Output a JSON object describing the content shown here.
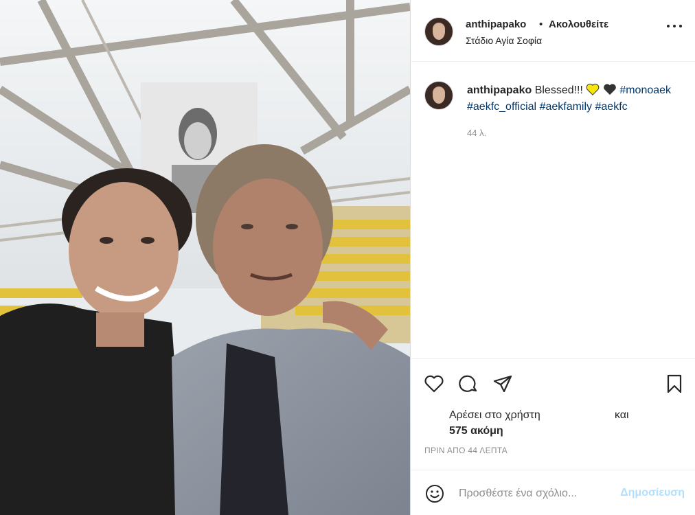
{
  "post": {
    "photo_alt": "anthipapako selfie"
  },
  "header": {
    "username": "anthipapako",
    "dot": "•",
    "follow_label": "Ακολουθείτε",
    "location": "Στάδιο Αγία Σοφία"
  },
  "caption": {
    "username": "anthipapako",
    "text": "Blessed!!!",
    "hashtags": [
      "#monoaek",
      "#aekfc_official",
      "#aekfamily",
      "#aekfc"
    ],
    "time_ago": "44 λ."
  },
  "actions": {
    "icons": [
      "heart-icon",
      "comment-icon",
      "share-icon",
      "bookmark-icon"
    ],
    "likes_prefix": "Αρέσει στο χρήστη",
    "likes_and": "και",
    "likes_count": "575 ακόμη",
    "post_time": "ΠΡΙΝ ΑΠΟ 44 ΛΕΠΤΑ"
  },
  "comment": {
    "placeholder": "Προσθέστε ένα σχόλιο...",
    "post_label": "Δημοσίευση"
  },
  "colors": {
    "link": "#00376b",
    "post_disabled": "#b2dffc",
    "muted": "#8e8e8e",
    "heart_yellow": "#f7e50e",
    "heart_black": "#333333"
  }
}
